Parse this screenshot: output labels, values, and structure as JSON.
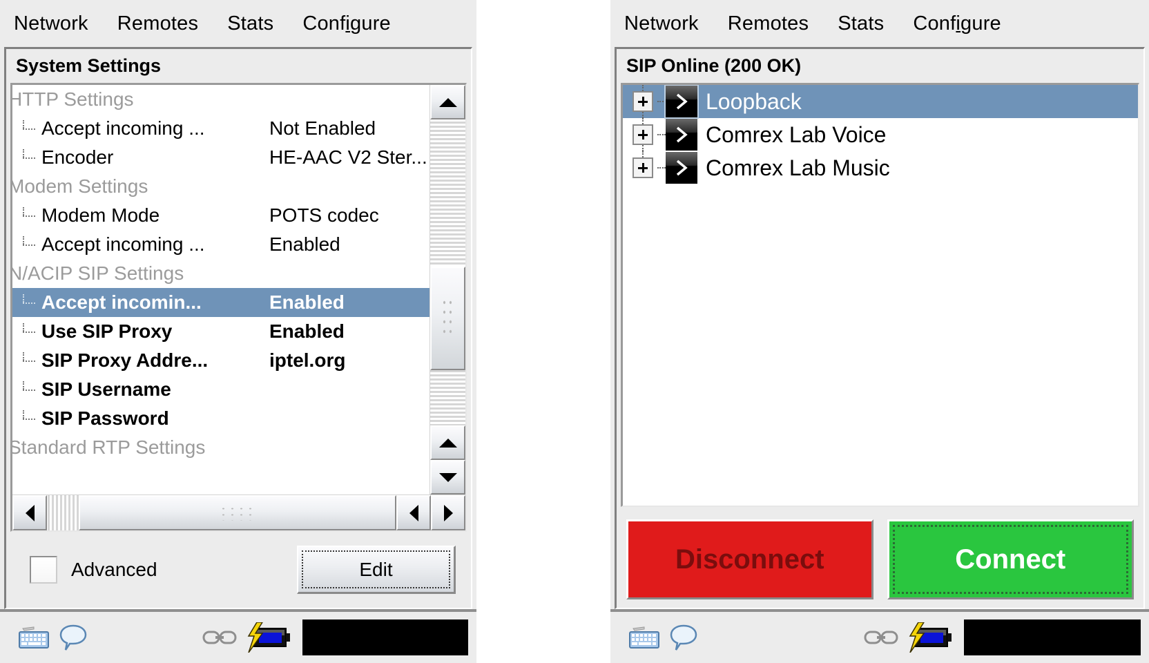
{
  "left_window": {
    "menubar": [
      {
        "label": "Network",
        "accel_index": -1
      },
      {
        "label": "Remotes",
        "accel_index": -1
      },
      {
        "label": "Stats",
        "accel_index": -1
      },
      {
        "label": "Configure",
        "accel_index": 4
      }
    ],
    "title": "System Settings",
    "settings_rows": [
      {
        "type": "group",
        "label": "HTTP Settings",
        "value": ""
      },
      {
        "type": "item",
        "label": "Accept incoming ...",
        "value": "Not Enabled",
        "bold": false,
        "selected": false
      },
      {
        "type": "item",
        "label": "Encoder",
        "value": "HE-AAC V2 Ster...",
        "bold": false,
        "selected": false
      },
      {
        "type": "group",
        "label": "Modem Settings",
        "value": ""
      },
      {
        "type": "item",
        "label": "Modem Mode",
        "value": "POTS codec",
        "bold": false,
        "selected": false
      },
      {
        "type": "item",
        "label": "Accept incoming ...",
        "value": "Enabled",
        "bold": false,
        "selected": false
      },
      {
        "type": "group",
        "label": "N/ACIP SIP Settings",
        "value": ""
      },
      {
        "type": "item",
        "label": "Accept incomin...",
        "value": "Enabled",
        "bold": true,
        "selected": true
      },
      {
        "type": "item",
        "label": "Use SIP Proxy",
        "value": "Enabled",
        "bold": true,
        "selected": false
      },
      {
        "type": "item",
        "label": "SIP Proxy Addre...",
        "value": "iptel.org",
        "bold": true,
        "selected": false
      },
      {
        "type": "item",
        "label": "SIP Username",
        "value": "",
        "bold": true,
        "selected": false
      },
      {
        "type": "item",
        "label": "SIP Password",
        "value": "",
        "bold": true,
        "selected": false
      },
      {
        "type": "group",
        "label": "Standard RTP Settings",
        "value": ""
      }
    ],
    "advanced_checkbox": {
      "label": "Advanced",
      "checked": false
    },
    "edit_button": {
      "label": "Edit",
      "focused": true
    },
    "scroll": {
      "vertical_up_arrow": "▲",
      "vertical_down_arrow": "▼",
      "horizontal_left_arrow": "◄",
      "horizontal_right_arrow": "►"
    }
  },
  "right_window": {
    "menubar": [
      {
        "label": "Network",
        "accel_index": -1
      },
      {
        "label": "Remotes",
        "accel_index": -1
      },
      {
        "label": "Stats",
        "accel_index": -1
      },
      {
        "label": "Configure",
        "accel_index": 4
      }
    ],
    "title": "SIP Online (200 OK)",
    "tree_items": [
      {
        "label": "Loopback",
        "expanded": false,
        "selected": true,
        "icon": "remote-device-icon"
      },
      {
        "label": "Comrex Lab Voice",
        "expanded": false,
        "selected": false,
        "icon": "remote-device-icon"
      },
      {
        "label": "Comrex Lab Music",
        "expanded": false,
        "selected": false,
        "icon": "remote-device-icon"
      }
    ],
    "disconnect_button": {
      "label": "Disconnect",
      "enabled": false
    },
    "connect_button": {
      "label": "Connect",
      "enabled": true,
      "focused": true
    }
  },
  "taskbar": {
    "icons": [
      {
        "name": "keyboard-icon"
      },
      {
        "name": "speech-bubble-icon"
      },
      {
        "name": "link-chain-icon"
      },
      {
        "name": "battery-charging-icon"
      }
    ]
  },
  "colors": {
    "selection_blue": "#6f93b8",
    "connect_green": "#2ac63f",
    "disconnect_red": "#e01b1b",
    "disconnect_text": "#7a0d0d",
    "window_face": "#ececec",
    "group_header_gray": "#9b9b9b"
  }
}
